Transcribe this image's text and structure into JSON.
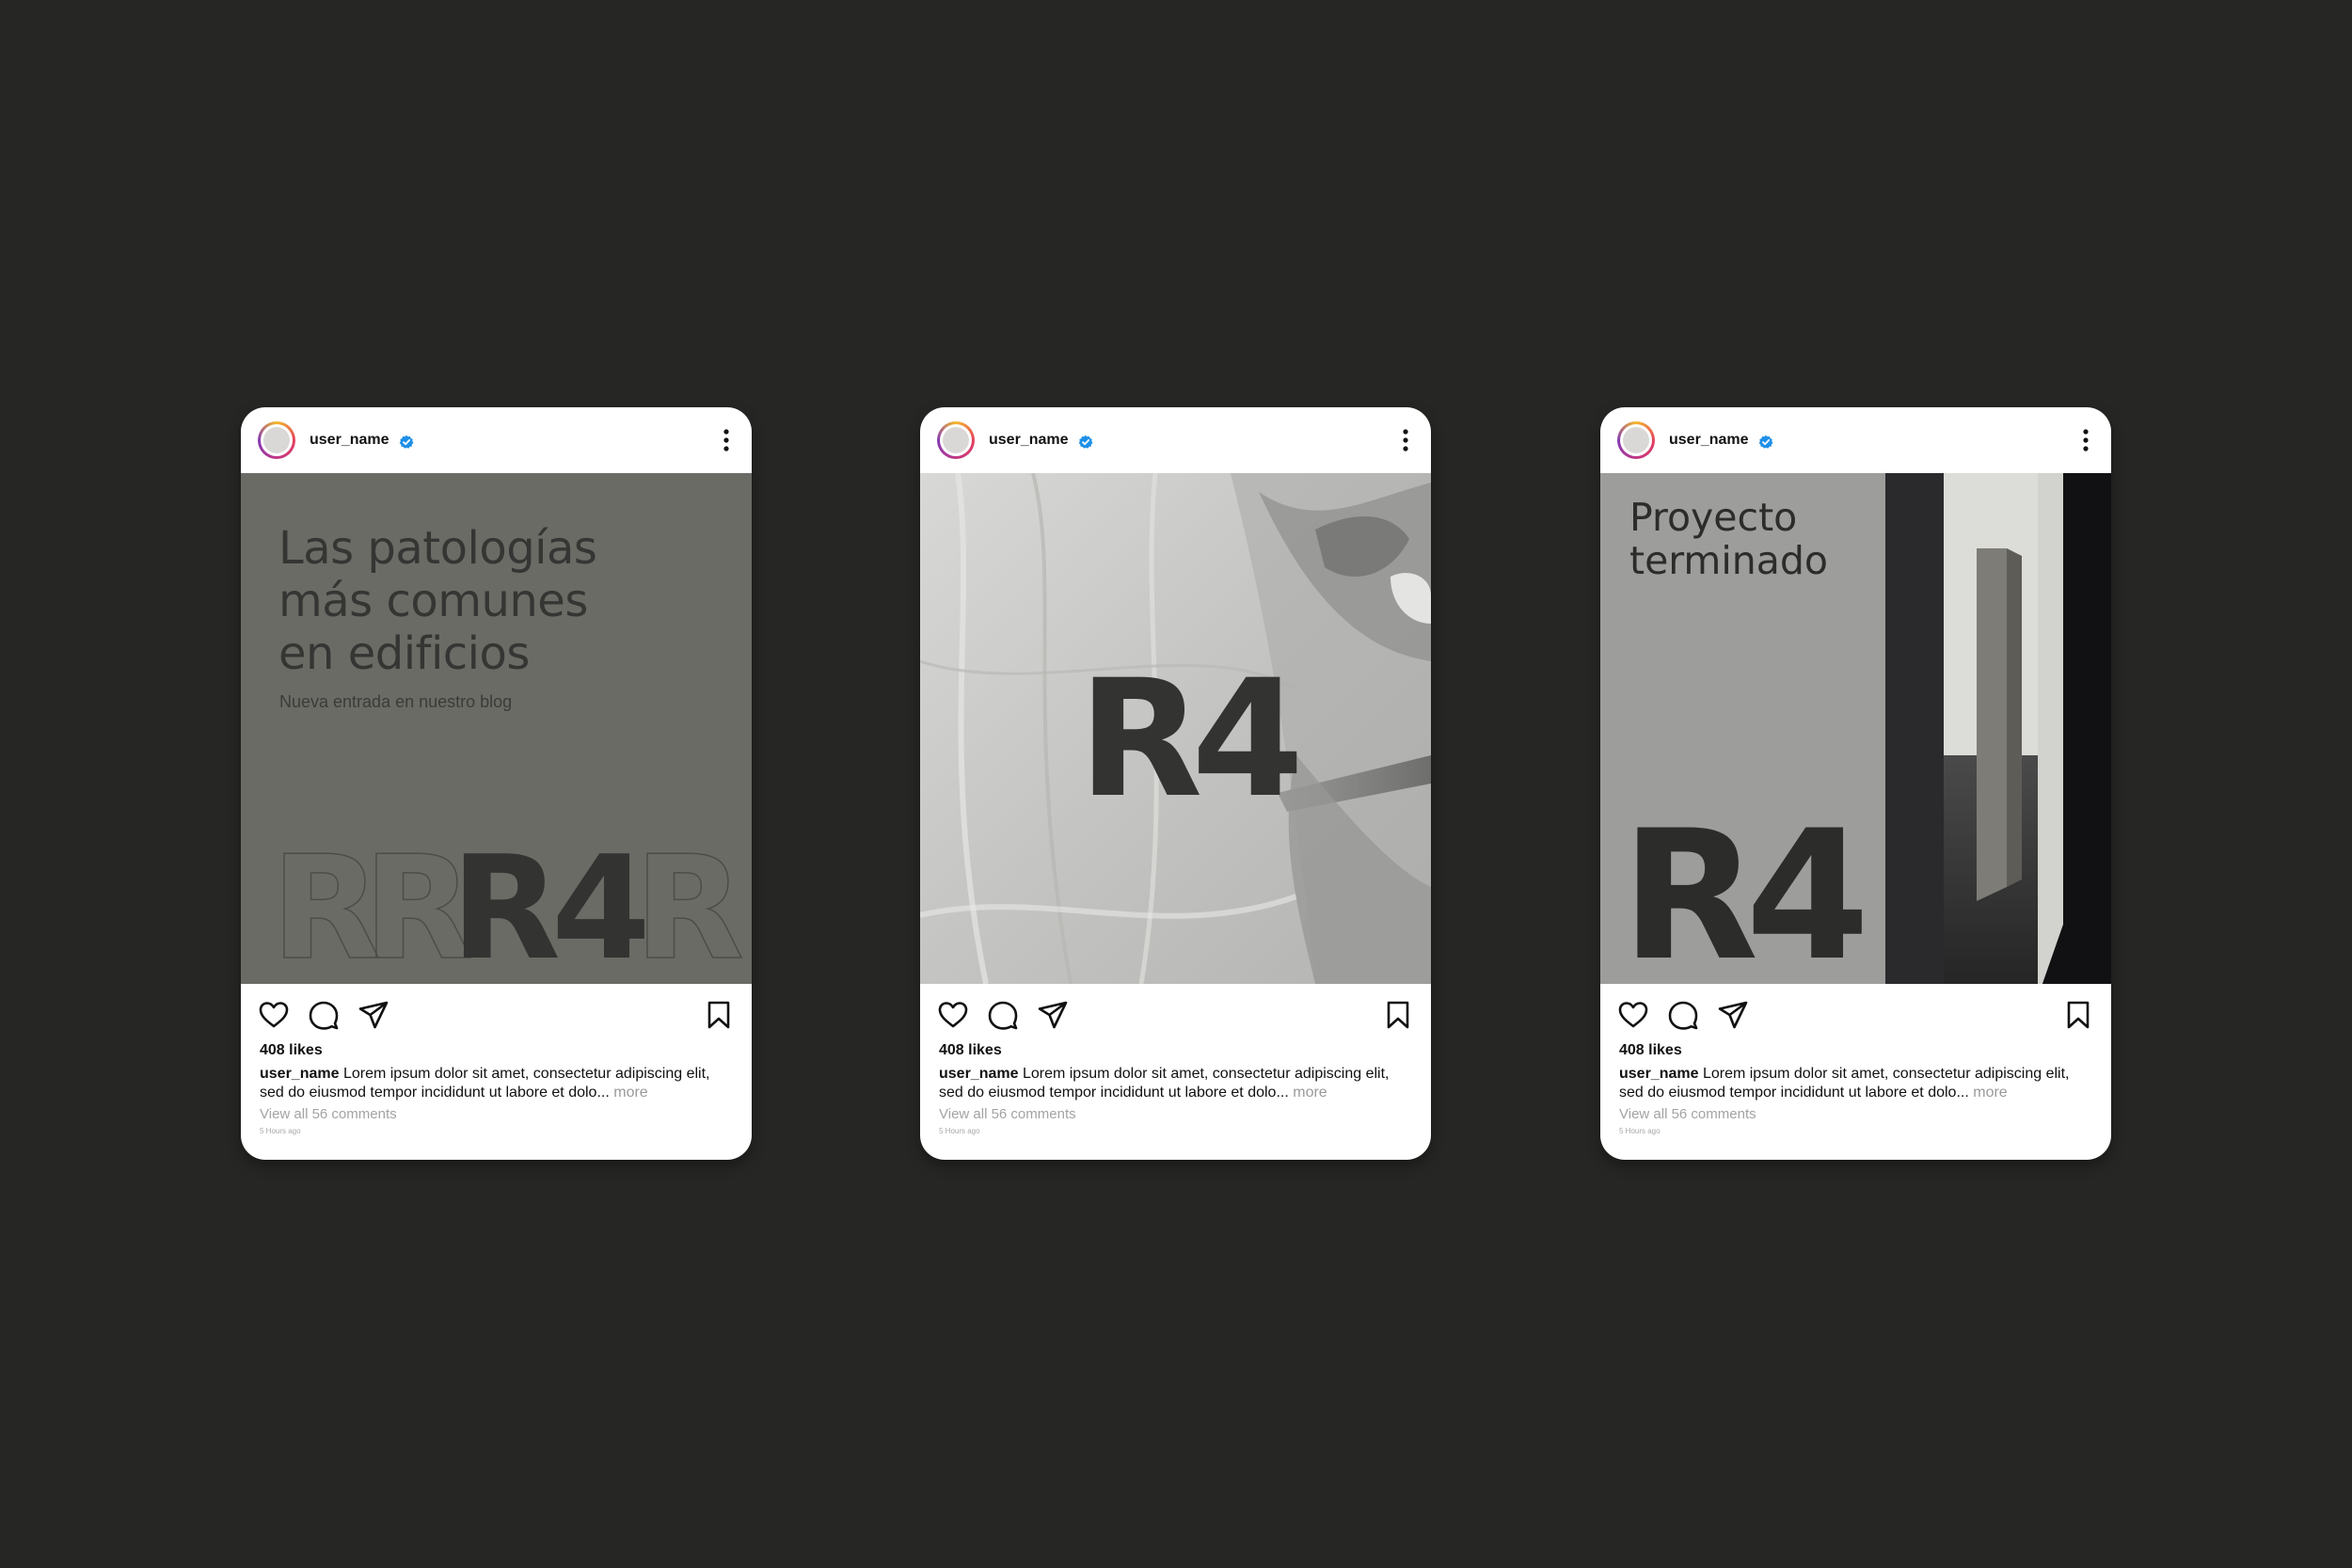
{
  "colors": {
    "background": "#262624",
    "verified": "#1d8fe8",
    "post1_bg": "#6b6b66",
    "post2_bg": "#c7c7c5",
    "post3_bg": "#9d9e9b",
    "brand_dark": "#333332"
  },
  "icons": [
    "verified-badge-icon",
    "more-options-icon",
    "heart-icon",
    "comment-icon",
    "share-icon",
    "bookmark-icon"
  ],
  "posts": [
    {
      "username": "user_name",
      "media": {
        "title": "Las patologías\nmás comunes\nen edificios",
        "subtitle": "Nueva entrada en nuestro blog",
        "logo": "R4"
      },
      "likes": "408 likes",
      "caption_user": "user_name",
      "caption_text": "Lorem ipsum dolor sit amet, consectetur adipiscing elit, sed do eiusmod tempor incididunt ut labore et dolo...",
      "more": "more",
      "view_comments": "View all 56 comments",
      "time": "5 Hours ago"
    },
    {
      "username": "user_name",
      "media": {
        "logo": "R4"
      },
      "likes": "408 likes",
      "caption_user": "user_name",
      "caption_text": "Lorem ipsum dolor sit amet, consectetur adipiscing elit, sed do eiusmod tempor incididunt ut labore et dolo...",
      "more": "more",
      "view_comments": "View all 56 comments",
      "time": "5 Hours ago"
    },
    {
      "username": "user_name",
      "media": {
        "title": "Proyecto\nterminado",
        "logo": "R4"
      },
      "likes": "408 likes",
      "caption_user": "user_name",
      "caption_text": "Lorem ipsum dolor sit amet, consectetur adipiscing elit, sed do eiusmod tempor incididunt ut labore et dolo...",
      "more": "more",
      "view_comments": "View all 56 comments",
      "time": "5 Hours ago"
    }
  ]
}
